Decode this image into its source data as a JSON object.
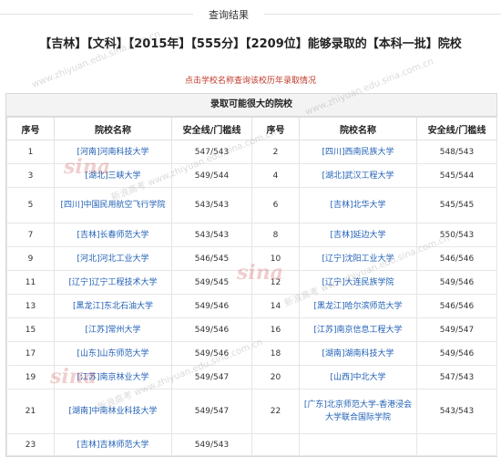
{
  "header": {
    "title": "查询结果"
  },
  "main_title": "【吉林】【文科】【2015年】【555分】【2209位】能够录取的【本科一批】院校",
  "hint": "点击学校名称查询该校历年录取情况",
  "table": {
    "caption": "录取可能很大的院校",
    "columns": [
      "序号",
      "院校名称",
      "安全线/门槛线",
      "序号",
      "院校名称",
      "安全线/门槛线"
    ],
    "rows": [
      {
        "left": {
          "no": "1",
          "name": "[河南]河南科技大学",
          "score": "547/543"
        },
        "right": {
          "no": "2",
          "name": "[四川]西南民族大学",
          "score": "548/543"
        }
      },
      {
        "left": {
          "no": "3",
          "name": "[湖北]三峡大学",
          "score": "549/544"
        },
        "right": {
          "no": "4",
          "name": "[湖北]武汉工程大学",
          "score": "545/544"
        }
      },
      {
        "left": {
          "no": "5",
          "name": "[四川]中国民用航空飞行学院",
          "score": "543/543"
        },
        "right": {
          "no": "6",
          "name": "[吉林]北华大学",
          "score": "545/545"
        }
      },
      {
        "left": {
          "no": "7",
          "name": "[吉林]长春师范大学",
          "score": "543/543"
        },
        "right": {
          "no": "8",
          "name": "[吉林]延边大学",
          "score": "550/543"
        }
      },
      {
        "left": {
          "no": "9",
          "name": "[河北]河北工业大学",
          "score": "546/545"
        },
        "right": {
          "no": "10",
          "name": "[辽宁]沈阳工业大学",
          "score": "546/546"
        }
      },
      {
        "left": {
          "no": "11",
          "name": "[辽宁]辽宁工程技术大学",
          "score": "549/545"
        },
        "right": {
          "no": "12",
          "name": "[辽宁]大连民族学院",
          "score": "549/546"
        }
      },
      {
        "left": {
          "no": "13",
          "name": "[黑龙江]东北石油大学",
          "score": "549/546"
        },
        "right": {
          "no": "14",
          "name": "[黑龙江]哈尔滨师范大学",
          "score": "546/546"
        }
      },
      {
        "left": {
          "no": "15",
          "name": "[江苏]常州大学",
          "score": "549/546"
        },
        "right": {
          "no": "16",
          "name": "[江苏]南京信息工程大学",
          "score": "549/547"
        }
      },
      {
        "left": {
          "no": "17",
          "name": "[山东]山东师范大学",
          "score": "549/546"
        },
        "right": {
          "no": "18",
          "name": "[湖南]湖南科技大学",
          "score": "549/546"
        }
      },
      {
        "left": {
          "no": "19",
          "name": "[江苏]南京林业大学",
          "score": "549/547"
        },
        "right": {
          "no": "20",
          "name": "[山西]中北大学",
          "score": "547/543"
        }
      },
      {
        "left": {
          "no": "21",
          "name": "[湖南]中南林业科技大学",
          "score": "549/547"
        },
        "right": {
          "no": "22",
          "name": "[广东]北京师范大学-香港浸会大学联合国际学院",
          "score": "543/543"
        }
      },
      {
        "left": {
          "no": "23",
          "name": "[吉林]吉林师范大学",
          "score": "549/543"
        },
        "right": {
          "no": "",
          "name": "",
          "score": ""
        }
      }
    ]
  },
  "watermark": {
    "logo": "sina",
    "text1": "新浪高考",
    "text2": "www.zhiyuan.edu.sina.com.cn"
  }
}
